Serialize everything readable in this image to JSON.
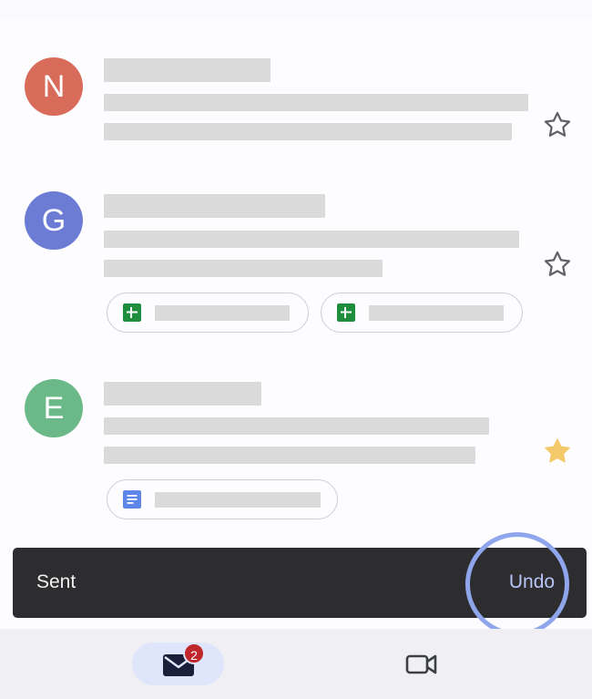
{
  "emails": [
    {
      "avatar_letter": "N",
      "avatar_color": "#d86b5a",
      "starred": false
    },
    {
      "avatar_letter": "G",
      "avatar_color": "#6c7bd3",
      "starred": false
    },
    {
      "avatar_letter": "E",
      "avatar_color": "#6bb888",
      "starred": true
    }
  ],
  "attachment_icons": [
    "sheets-icon",
    "sheets-icon",
    "docs-icon"
  ],
  "colors": {
    "star_outline": "#5f6368",
    "star_filled": "#f4c96b",
    "sheets": "#1e8e3e",
    "docs": "#5e86e8",
    "accent": "#8fa6ec"
  },
  "snackbar": {
    "message": "Sent",
    "action_label": "Undo"
  },
  "bottom_nav": {
    "mail_badge": "2"
  }
}
